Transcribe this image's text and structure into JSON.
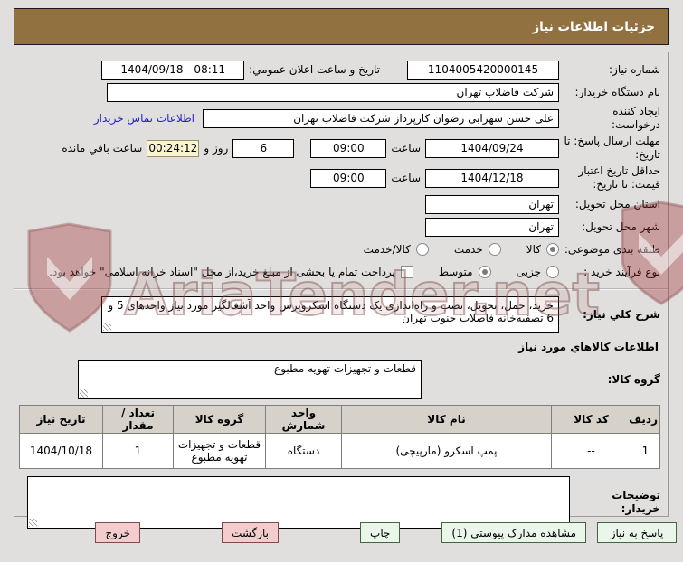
{
  "title": "جزئیات اطلاعات نیاز",
  "watermark": {
    "text": "AriaTender.net"
  },
  "fields": {
    "need_number": {
      "label": "شماره نیاز:",
      "value": "1104005420000145"
    },
    "announce_datetime": {
      "label": "تاریخ و ساعت اعلان عمومي:",
      "value": "1404/09/18 - 08:11"
    },
    "buyer_org": {
      "label": "نام دستگاه خریدار:",
      "value": "شرکت فاضلاب تهران"
    },
    "request_creator": {
      "label": "ایجاد کننده درخواست:",
      "value": "علی حسن سهرابی رضوان کارپرداز شرکت فاضلاب تهران",
      "link": "اطلاعات تماس خریدار"
    },
    "response_deadline": {
      "label": "مهلت ارسال پاسخ: تا تاریخ:",
      "date": "1404/09/24",
      "hour_label": "ساعت",
      "time": "09:00",
      "days_value": "6",
      "days_label": "روز و",
      "countdown": "00:24:12",
      "countdown_label": "ساعت باقي مانده"
    },
    "price_validity": {
      "label": "حداقل تاریخ اعتبار قیمت: تا تاریخ:",
      "date": "1404/12/18",
      "hour_label": "ساعت",
      "time": "09:00"
    },
    "province": {
      "label": "استان محل تحویل:",
      "value": "تهران"
    },
    "city": {
      "label": "شهر محل تحویل:",
      "value": "تهران"
    },
    "classification": {
      "label": "طبقه بندی موضوعی:",
      "options": [
        {
          "label": "کالا",
          "selected": true
        },
        {
          "label": "خدمت",
          "selected": false
        },
        {
          "label": "کالا/خدمت",
          "selected": false
        }
      ]
    },
    "process_type": {
      "label": "نوع فرآیند خرید :",
      "options": [
        {
          "label": "جزیی",
          "selected": false
        },
        {
          "label": "متوسط",
          "selected": true
        }
      ],
      "checkbox_label": "پرداخت تمام یا بخشی از مبلغ خرید،از محل \"اسناد خزانه اسلامی\" خواهد بود.",
      "checkbox_checked": false
    },
    "general_desc": {
      "label": "شرح کلي نیاز:",
      "value": "خرید، حمل، تحویل، نصب و راه‌اندازی یک دستگاه اسکروپرس واحد آشغالگیر مورد نیاز واحدهای 5 و 6 تصفیه‌خانه فاضلاب جنوب تهران"
    },
    "goods_section_title": "اطلاعات کالاهاي مورد نیاز",
    "product_group": {
      "label": "گروه کالا:",
      "value": "قطعات و تجهیزات تهویه مطبوع"
    },
    "buyer_notes": {
      "label": "توضیحات خریدار:",
      "value": ""
    }
  },
  "table": {
    "headers": [
      "ردیف",
      "کد کالا",
      "نام کالا",
      "واحد شمارش",
      "گروه کالا",
      "تعداد / مقدار",
      "تاریخ نیاز"
    ],
    "rows": [
      [
        "1",
        "--",
        "پمپ اسکرو (مارپیچی)",
        "دستگاه",
        "قطعات و تجهیزات تهویه مطبوع",
        "1",
        "1404/10/18"
      ]
    ]
  },
  "buttons": [
    {
      "label": "پاسخ به نیاز",
      "style": "green"
    },
    {
      "label": "مشاهده مدارک پیوستي (1)",
      "style": "green"
    },
    {
      "label": "چاپ",
      "style": "green"
    },
    {
      "label": "بازگشت",
      "style": "pink"
    },
    {
      "label": "خروج",
      "style": "pink"
    }
  ],
  "colors": {
    "title_bar": "#927140",
    "countdown_bg": "#faf3cf",
    "link": "#2323c8",
    "watermark_red": "#9c2b30",
    "button_green": "#e9f6e9",
    "button_pink": "#f5ccce"
  }
}
